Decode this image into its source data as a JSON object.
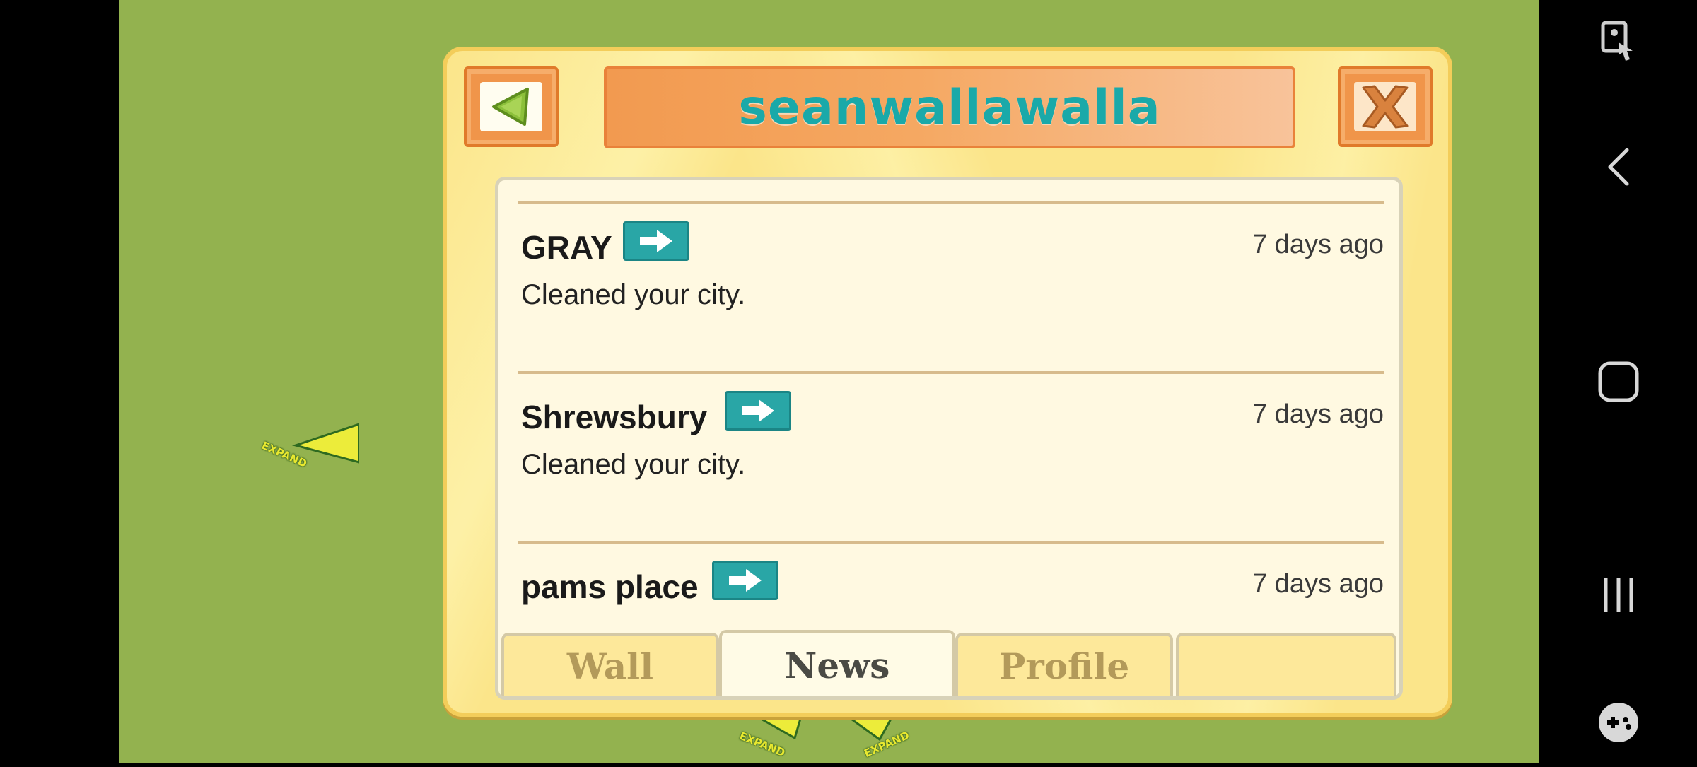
{
  "dialog": {
    "title": "seanwallawalla",
    "back_icon": "triangle-left-icon",
    "close_icon": "x-icon",
    "feed": [
      {
        "name": "GRAY",
        "time": "7 days ago",
        "message": "Cleaned your city."
      },
      {
        "name": "Shrewsbury",
        "time": "7 days ago",
        "message": "Cleaned your city."
      },
      {
        "name": "pams place",
        "time": "7 days ago",
        "message": ""
      }
    ],
    "tabs": [
      {
        "label": "Wall",
        "active": false
      },
      {
        "label": "News",
        "active": true
      },
      {
        "label": "Profile",
        "active": false
      },
      {
        "label": "",
        "active": false
      }
    ]
  },
  "background": {
    "expand_label": "EXPAND"
  },
  "navbar": {
    "icons": [
      "accessibility-touch-icon",
      "back-chevron-icon",
      "home-square-icon",
      "recents-icon",
      "game-controller-icon"
    ]
  },
  "colors": {
    "title_teal": "#1aa9a9",
    "dialog_yellow": "#fbe58a",
    "button_orange": "#f0954a",
    "go_button_teal": "#29a6a6",
    "background_green": "#93b24f"
  }
}
